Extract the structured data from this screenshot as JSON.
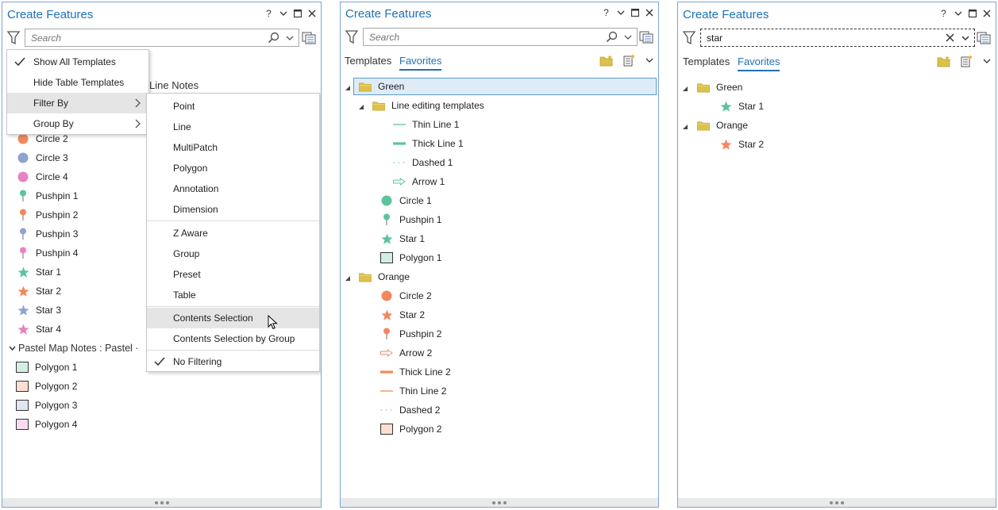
{
  "colors": {
    "accent": "#1e70b8",
    "green": "#5cc49a",
    "orange": "#f4875e",
    "blue": "#8fa3d1",
    "pink": "#e683c0",
    "folder": "#dcc24a"
  },
  "icons": {
    "filter": "filter-icon",
    "search": "search-icon",
    "clear": "close-icon",
    "dropdown": "chevron-down-icon",
    "options": "options-icon",
    "folder": "folder-icon",
    "new_folder": "new-folder-icon",
    "grip": "grip-icon"
  },
  "window": {
    "help": "?",
    "minimize": "⌄",
    "maximize": "□",
    "close": "✕"
  },
  "pane1": {
    "title": "Create Features",
    "search_placeholder": "Search",
    "group_header_1": "Line Notes",
    "group_header_2": "Pastel Map Notes : Pastel ·",
    "menu": {
      "items": [
        {
          "label": "Show All Templates",
          "checked": true
        },
        {
          "label": "Hide Table Templates",
          "checked": false
        },
        {
          "label": "Filter By",
          "submenu": true
        },
        {
          "label": "Group By",
          "submenu": true
        }
      ]
    },
    "submenu": {
      "group1": [
        "Point",
        "Line",
        "MultiPatch",
        "Polygon",
        "Annotation",
        "Dimension"
      ],
      "group2": [
        "Z Aware",
        "Group",
        "Preset",
        "Table",
        "Contents Selection",
        "Contents Selection by Group"
      ],
      "group3": [
        "No Filtering"
      ]
    },
    "items": [
      {
        "label": "Circle 2",
        "symbol": "circle",
        "color": "#f4875e"
      },
      {
        "label": "Circle 3",
        "symbol": "circle",
        "color": "#8fa3d1"
      },
      {
        "label": "Circle 4",
        "symbol": "circle",
        "color": "#e683c0"
      },
      {
        "label": "Pushpin 1",
        "symbol": "pushpin",
        "color": "#5cc49a"
      },
      {
        "label": "Pushpin 2",
        "symbol": "pushpin",
        "color": "#f4875e"
      },
      {
        "label": "Pushpin 3",
        "symbol": "pushpin",
        "color": "#8fa3d1"
      },
      {
        "label": "Pushpin 4",
        "symbol": "pushpin",
        "color": "#e683c0"
      },
      {
        "label": "Star 1",
        "symbol": "star",
        "color": "#5cc49a"
      },
      {
        "label": "Star 2",
        "symbol": "star",
        "color": "#f4875e"
      },
      {
        "label": "Star 3",
        "symbol": "star",
        "color": "#8fa3d1"
      },
      {
        "label": "Star 4",
        "symbol": "star",
        "color": "#e683c0"
      }
    ],
    "polygons": [
      {
        "label": "Polygon 1",
        "color": "#5cc49a"
      },
      {
        "label": "Polygon 2",
        "color": "#f4875e"
      },
      {
        "label": "Polygon 3",
        "color": "#8fa3d1"
      },
      {
        "label": "Polygon 4",
        "color": "#e683c0"
      }
    ]
  },
  "pane2": {
    "title": "Create Features",
    "search_placeholder": "Search",
    "tabs": [
      "Templates",
      "Favorites"
    ],
    "folders": {
      "green": "Green",
      "line_editing": "Line editing templates",
      "orange": "Orange"
    },
    "line_items": [
      {
        "label": "Thin Line 1",
        "symbol": "thin",
        "color": "#5cc49a"
      },
      {
        "label": "Thick Line 1",
        "symbol": "thick",
        "color": "#5cc49a"
      },
      {
        "label": "Dashed 1",
        "symbol": "dashed",
        "color": "#5cc49a"
      },
      {
        "label": "Arrow 1",
        "symbol": "arrow",
        "color": "#5cc49a"
      }
    ],
    "green_items": [
      {
        "label": "Circle 1",
        "symbol": "circle",
        "color": "#5cc49a"
      },
      {
        "label": "Pushpin 1",
        "symbol": "pushpin",
        "color": "#5cc49a"
      },
      {
        "label": "Star 1",
        "symbol": "star",
        "color": "#5cc49a"
      },
      {
        "label": "Polygon 1",
        "symbol": "polygon",
        "color": "#5cc49a"
      }
    ],
    "orange_items": [
      {
        "label": "Circle 2",
        "symbol": "circle",
        "color": "#f4875e"
      },
      {
        "label": "Star 2",
        "symbol": "star",
        "color": "#f4875e"
      },
      {
        "label": "Pushpin 2",
        "symbol": "pushpin",
        "color": "#f4875e"
      },
      {
        "label": "Arrow 2",
        "symbol": "arrow",
        "color": "#f4875e"
      },
      {
        "label": "Thick Line 2",
        "symbol": "thick",
        "color": "#f4875e"
      },
      {
        "label": "Thin Line 2",
        "symbol": "thin",
        "color": "#f4875e"
      },
      {
        "label": "Dashed 2",
        "symbol": "dashed",
        "color": "#f4875e"
      },
      {
        "label": "Polygon 2",
        "symbol": "polygon",
        "color": "#f4875e"
      }
    ]
  },
  "pane3": {
    "title": "Create Features",
    "search_value": "star",
    "tabs": [
      "Templates",
      "Favorites"
    ],
    "folders": {
      "green": "Green",
      "orange": "Orange"
    },
    "green_items": [
      {
        "label": "Star 1",
        "symbol": "star",
        "color": "#5cc49a"
      }
    ],
    "orange_items": [
      {
        "label": "Star 2",
        "symbol": "star",
        "color": "#f4875e"
      }
    ]
  }
}
